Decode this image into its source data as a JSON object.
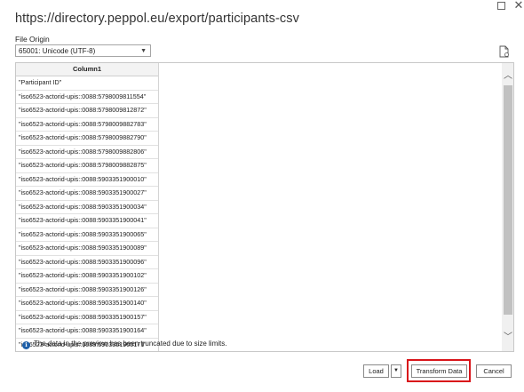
{
  "window": {
    "title": "https://directory.peppol.eu/export/participants-csv",
    "maximize_glyph": "",
    "close_glyph": "✕"
  },
  "file_origin": {
    "label": "File Origin",
    "selected": "65001: Unicode (UTF-8)"
  },
  "table": {
    "header": "Column1",
    "rows": [
      "\"Participant ID\"",
      "\"iso6523-actorid-upis::0088:5798009811554\"",
      "\"iso6523-actorid-upis::0088:5798009812872\"",
      "\"iso6523-actorid-upis::0088:5798009882783\"",
      "\"iso6523-actorid-upis::0088:5798009882790\"",
      "\"iso6523-actorid-upis::0088:5798009882806\"",
      "\"iso6523-actorid-upis::0088:5798009882875\"",
      "\"iso6523-actorid-upis::0088:5903351900010\"",
      "\"iso6523-actorid-upis::0088:5903351900027\"",
      "\"iso6523-actorid-upis::0088:5903351900034\"",
      "\"iso6523-actorid-upis::0088:5903351900041\"",
      "\"iso6523-actorid-upis::0088:5903351900065\"",
      "\"iso6523-actorid-upis::0088:5903351900089\"",
      "\"iso6523-actorid-upis::0088:5903351900096\"",
      "\"iso6523-actorid-upis::0088:5903351900102\"",
      "\"iso6523-actorid-upis::0088:5903351900126\"",
      "\"iso6523-actorid-upis::0088:5903351900140\"",
      "\"iso6523-actorid-upis::0088:5903351900157\"",
      "\"iso6523-actorid-upis::0088:5903351900164\"",
      "\"iso6523-actorid-upis::0088:5903351900171\""
    ]
  },
  "notice": {
    "icon": "info-icon",
    "text": "The data in the preview has been truncated due to size limits."
  },
  "footer": {
    "load_label": "Load",
    "transform_label": "Transform Data",
    "cancel_label": "Cancel"
  },
  "colors": {
    "highlight": "#d9141a",
    "info": "#1e5fa8"
  }
}
